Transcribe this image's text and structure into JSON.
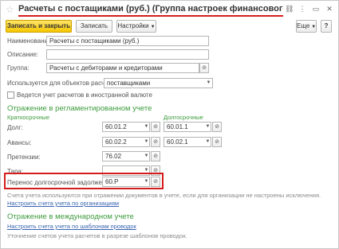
{
  "window": {
    "title": "Расчеты с постащиками (руб.) (Группа настроек финансового учета расче...",
    "icons": [
      "link-icon",
      "more-icon",
      "minimize-icon",
      "maximize-icon",
      "close-icon"
    ]
  },
  "toolbar": {
    "save_close_label": "Записать и закрыть",
    "save_label": "Записать",
    "settings_label": "Настройки",
    "more_label": "Еще",
    "help_label": "?"
  },
  "form": {
    "name_label": "Наименование:",
    "name_value": "Расчеты с постащиками (руб.)",
    "description_label": "Описание:",
    "description_value": "",
    "group_label": "Группа:",
    "group_value": "Расчеты с дебиторами и кредиторами",
    "used_for_label": "Используется для объектов расчетов с :",
    "used_for_value": "поставщиками",
    "foreign_currency_label": "Ведется учет расчетов в иностранной валюте"
  },
  "regulated": {
    "section_title": "Отражение в регламентированном учете",
    "short_term_label": "Краткосрочные",
    "long_term_label": "Долгосрочные",
    "rows": [
      {
        "label": "Долг:",
        "short": "60.01.2",
        "long": "60.01.1"
      },
      {
        "label": "Авансы:",
        "short": "60.02.2",
        "long": "60.02.1"
      },
      {
        "label": "Претензии:",
        "short": "76.02",
        "long": ""
      },
      {
        "label": "Тара:",
        "short": "",
        "long": ""
      }
    ],
    "transfer_label": "Перенос долгосрочной задолженности:",
    "transfer_value": "60.Р",
    "hint": "Счета учета используются при отражении документов в учете, если для организации не настроены исключения.",
    "link": "Настроить счета учета по организациям"
  },
  "international": {
    "section_title": "Отражение в международном учете",
    "link": "Настроить счета учета по шаблонам проводок",
    "hint": "Уточнение счетов учета расчетов в разрезе шаблонов проводок."
  },
  "colors": {
    "accent_green": "#3c9b3c",
    "highlight_red": "#d41c1c",
    "primary_yellow": "#f5c600",
    "link_blue": "#3a64b0"
  }
}
